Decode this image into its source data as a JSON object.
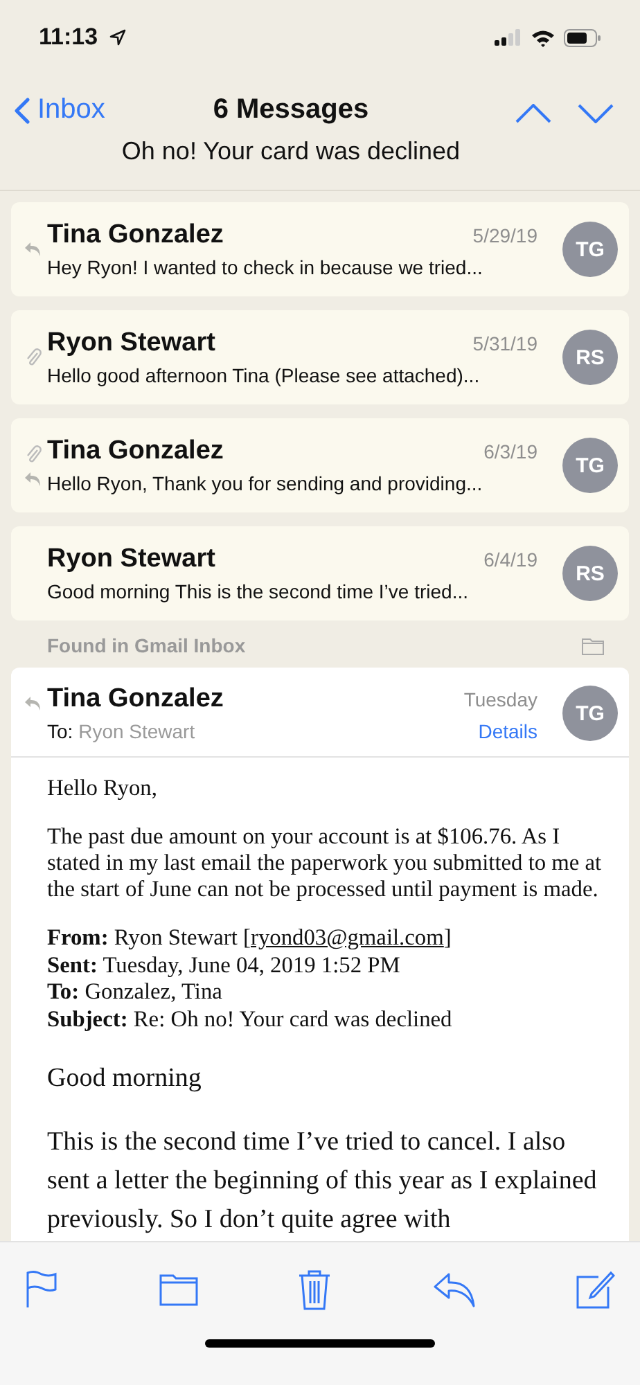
{
  "status_bar": {
    "time": "11:13"
  },
  "nav": {
    "back": "Inbox",
    "title": "6 Messages",
    "subject": "Oh no! Your card was declined"
  },
  "messages": [
    {
      "sender": "Tina Gonzalez",
      "date": "5/29/19",
      "preview": "Hey Ryon! I wanted to check in because we tried...",
      "initials": "TG",
      "replied": true,
      "attachment": false
    },
    {
      "sender": "Ryon Stewart",
      "date": "5/31/19",
      "preview": "Hello good afternoon Tina (Please see attached)...",
      "initials": "RS",
      "replied": false,
      "attachment": true
    },
    {
      "sender": "Tina Gonzalez",
      "date": "6/3/19",
      "preview": "Hello Ryon, Thank you for sending and providing...",
      "initials": "TG",
      "replied": true,
      "attachment": true
    },
    {
      "sender": "Ryon Stewart",
      "date": "6/4/19",
      "preview": "Good morning This is the second time I’ve tried...",
      "initials": "RS",
      "replied": false,
      "attachment": false
    }
  ],
  "found_label": "Found in Gmail Inbox",
  "open_message": {
    "sender": "Tina Gonzalez",
    "to_label": "To:",
    "to": "Ryon Stewart",
    "date": "Tuesday",
    "details": "Details",
    "initials": "TG",
    "replied": true,
    "body": [
      {
        "kind": "para",
        "text": "Hello Ryon,"
      },
      {
        "kind": "para",
        "text": "The past due amount on your account is at $106.76. As I stated in my last email the paperwork you submitted to me at the start of June can not be processed until payment is made."
      },
      {
        "kind": "header",
        "text": "**From:** Ryon Stewart [",
        "link": "ryond03@gmail.com",
        "after": "]"
      },
      {
        "kind": "header",
        "text": "**Sent:** Tuesday, June 04, 2019 1:52 PM"
      },
      {
        "kind": "header",
        "text": "**To:** Gonzalez, Tina"
      },
      {
        "kind": "header",
        "text": "**Subject:** Re: Oh no! Your card was declined"
      },
      {
        "kind": "large",
        "text": "Good morning"
      },
      {
        "kind": "large",
        "text": "This is the second time I’ve tried to cancel. I also sent a letter the beginning of this year as I explained previously. So I don’t quite agree with"
      }
    ]
  }
}
